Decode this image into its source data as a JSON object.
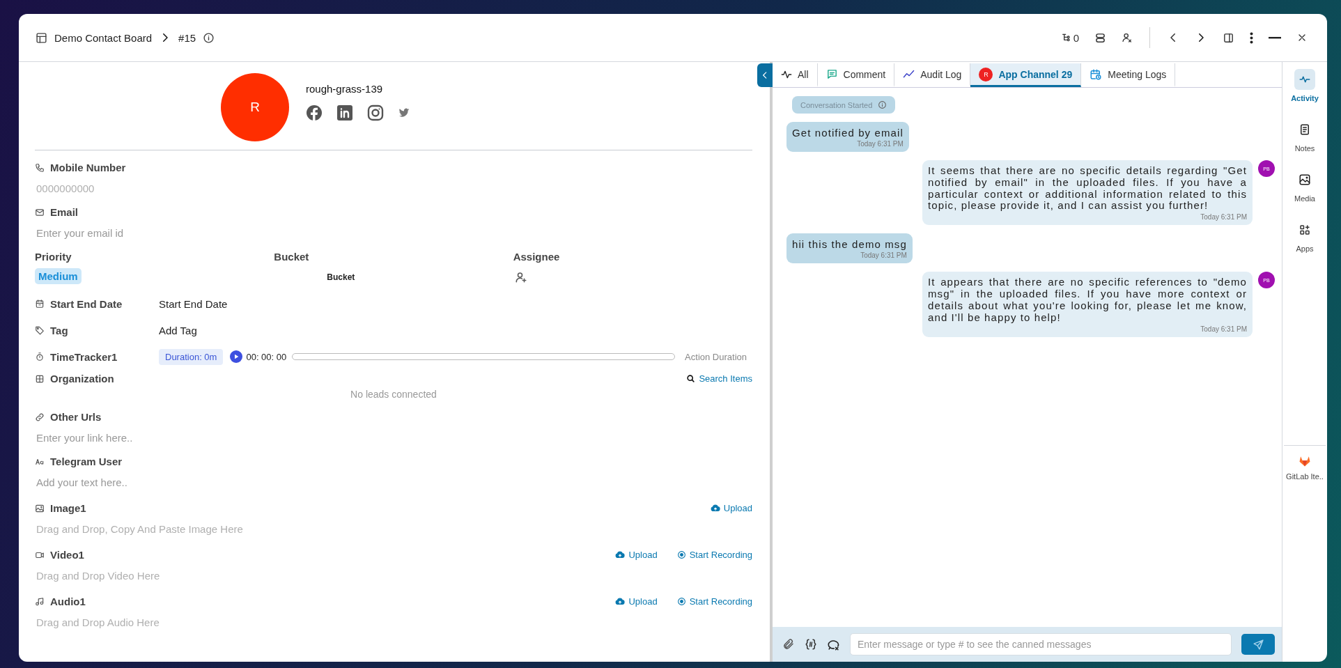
{
  "header": {
    "board": "Demo Contact Board",
    "item_id": "#15",
    "counter": "0"
  },
  "contact": {
    "avatar_letter": "R",
    "name": "rough-grass-139"
  },
  "fields": {
    "mobile_number": {
      "label": "Mobile Number",
      "placeholder": "0000000000"
    },
    "email": {
      "label": "Email",
      "placeholder": "Enter your email id"
    },
    "priority": {
      "label": "Priority",
      "value": "Medium"
    },
    "bucket": {
      "label": "Bucket",
      "value": "Bucket"
    },
    "assignee": {
      "label": "Assignee"
    },
    "start_end_date": {
      "label": "Start End Date",
      "value": "Start End Date"
    },
    "tag": {
      "label": "Tag",
      "value": "Add Tag"
    },
    "time_tracker": {
      "label": "TimeTracker1",
      "duration": "Duration: 0m",
      "time": "00: 00: 00",
      "caption": "Action Duration"
    },
    "organization": {
      "label": "Organization",
      "action": "Search Items",
      "empty": "No leads connected"
    },
    "other_urls": {
      "label": "Other Urls",
      "placeholder": "Enter your link here.."
    },
    "telegram_user": {
      "label": "Telegram User",
      "placeholder": "Add your text here.."
    },
    "image": {
      "label": "Image1",
      "actions": [
        {
          "kind": "upload",
          "label": "Upload"
        }
      ],
      "placeholder": "Drag and Drop, Copy And Paste Image Here"
    },
    "video": {
      "label": "Video1",
      "actions": [
        {
          "kind": "upload",
          "label": "Upload"
        },
        {
          "kind": "record",
          "label": "Start Recording"
        }
      ],
      "placeholder": "Drag and Drop Video Here"
    },
    "audio": {
      "label": "Audio1",
      "actions": [
        {
          "kind": "upload",
          "label": "Upload"
        },
        {
          "kind": "record",
          "label": "Start Recording"
        }
      ],
      "placeholder": "Drag and Drop Audio Here"
    }
  },
  "chat": {
    "tabs": [
      {
        "kind": "all",
        "label": "All",
        "selected": false
      },
      {
        "kind": "comment",
        "label": "Comment",
        "selected": false
      },
      {
        "kind": "audit",
        "label": "Audit Log",
        "selected": false
      },
      {
        "kind": "channel",
        "label": "App Channel 29",
        "badge": "R",
        "selected": true
      },
      {
        "kind": "meeting",
        "label": "Meeting Logs",
        "selected": false
      }
    ],
    "conversation_started": "Conversation Started",
    "messages": [
      {
        "kind": "received",
        "text": "Get notified by email",
        "time": "Today 6:31 PM"
      },
      {
        "kind": "sent",
        "text": "It seems that there are no specific details regarding \"Get notified by email\" in the uploaded files. If you have a particular context or additional information related to this topic, please provide it, and I can assist you further!",
        "time": "Today 6:31 PM",
        "avatar": "PB"
      },
      {
        "kind": "received",
        "text": "hii this the demo msg",
        "time": "Today 6:31 PM"
      },
      {
        "kind": "sent",
        "text": "It appears that there are no specific references to \"demo msg\" in the uploaded files. If you have more context or details about what you're looking for, please let me know, and I'll be happy to help!",
        "time": "Today 6:31 PM",
        "avatar": "PB"
      }
    ],
    "composer_placeholder": "Enter message or type # to see the canned messages"
  },
  "rail": {
    "items": [
      {
        "kind": "activity",
        "label": "Activity",
        "selected": true
      },
      {
        "kind": "notes",
        "label": "Notes",
        "selected": false
      },
      {
        "kind": "media",
        "label": "Media",
        "selected": false
      },
      {
        "kind": "apps",
        "label": "Apps",
        "selected": false
      }
    ],
    "apps": [
      {
        "label": "GitLab Ite.."
      }
    ]
  }
}
